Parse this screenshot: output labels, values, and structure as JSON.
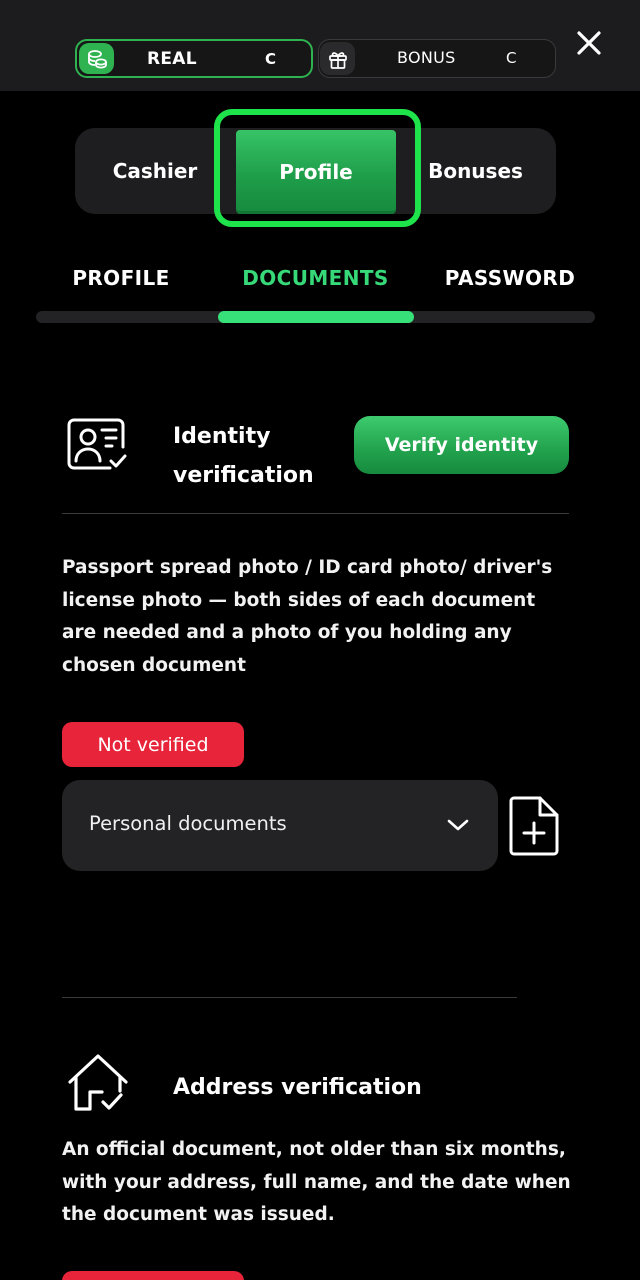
{
  "header": {
    "real_balance": {
      "label": "REAL",
      "mark": "C",
      "icon": "coins-icon"
    },
    "bonus_balance": {
      "label": "BONUS",
      "mark": "C",
      "icon": "gift-icon"
    },
    "close_icon": "close-icon"
  },
  "main_tabs": [
    {
      "label": "Cashier",
      "active": false
    },
    {
      "label": "Profile",
      "active": true
    },
    {
      "label": "Bonuses",
      "active": false
    }
  ],
  "sub_tabs": [
    {
      "label": "PROFILE",
      "active": false
    },
    {
      "label": "DOCUMENTS",
      "active": true
    },
    {
      "label": "PASSWORD",
      "active": false
    }
  ],
  "identity": {
    "icon": "id-card-icon",
    "title": "Identity verification",
    "verify_button": "Verify identity",
    "description": "Passport spread photo / ID card photo/ driver's license photo — both sides of each document are needed and a photo of you holding any chosen document",
    "status": "Not verified",
    "document_type": {
      "selected": "Personal documents",
      "icon": "chevron-down-icon"
    },
    "upload_icon": "file-add-icon"
  },
  "address": {
    "icon": "home-check-icon",
    "title": "Address verification",
    "description": "An official document, not older than six months, with your address, full name, and the date when the document was issued."
  },
  "colors": {
    "accent_green": "#2fb250",
    "active_tab_text": "#36d878",
    "highlight_ring": "#1ee34a",
    "status_red": "#e7243a",
    "panel": "#1e1e20"
  }
}
